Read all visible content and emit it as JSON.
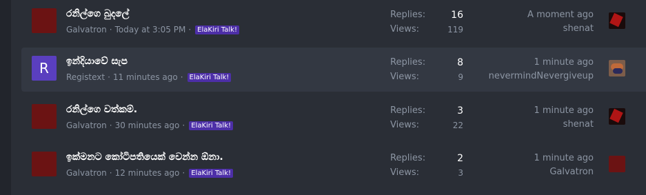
{
  "threads": [
    {
      "title": "රනිල්ගෙ බුදලේ",
      "author": "Galvatron",
      "time": "Today at 3:05 PM",
      "prefix": "ElaKiri Talk!",
      "replies_label": "Replies:",
      "replies": "16",
      "views_label": "Views:",
      "views": "119",
      "last_time": "A moment ago",
      "last_user": "shenat",
      "avatar_color": "#6b1313"
    },
    {
      "title": "ඉන්දියාවේ සැප",
      "author": "Registext",
      "avatar_letter": "R",
      "time": "11 minutes ago",
      "prefix": "ElaKiri Talk!",
      "replies_label": "Replies:",
      "replies": "8",
      "views_label": "Views:",
      "views": "9",
      "last_time": "1 minute ago",
      "last_user": "nevermindNevergiveup",
      "avatar_color": "#5a3fbf"
    },
    {
      "title": "රනිල්ගෙ වත්කම්.",
      "author": "Galvatron",
      "time": "30 minutes ago",
      "prefix": "ElaKiri Talk!",
      "replies_label": "Replies:",
      "replies": "3",
      "views_label": "Views:",
      "views": "22",
      "last_time": "1 minute ago",
      "last_user": "shenat",
      "avatar_color": "#6b1313"
    },
    {
      "title": "ඉක්මනට කෝටිපතියෙක් වෙන්න ඕනා.",
      "author": "Galvatron",
      "time": "12 minutes ago",
      "prefix": "ElaKiri Talk!",
      "replies_label": "Replies:",
      "replies": "2",
      "views_label": "Views:",
      "views": "3",
      "last_time": "1 minute ago",
      "last_user": "Galvatron",
      "avatar_color": "#6b1313"
    }
  ],
  "separator": "·",
  "colors": {
    "background": "#22252c",
    "panel": "#2a2e36",
    "highlight_row": "#333842",
    "prefix_badge": "#4d2fa8",
    "muted_text": "#8c95a3"
  }
}
